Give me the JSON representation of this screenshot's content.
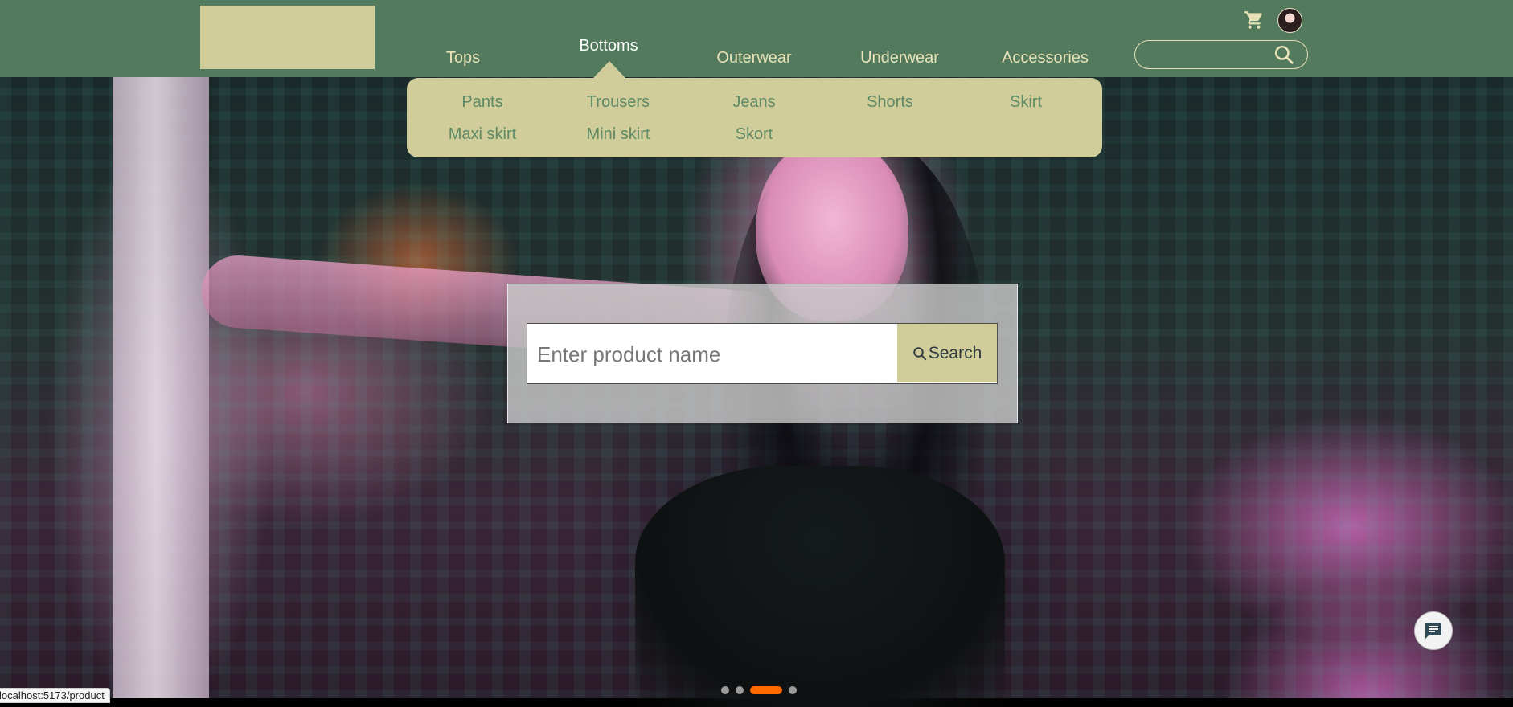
{
  "nav": {
    "items": [
      {
        "label": "Tops"
      },
      {
        "label": "Bottoms"
      },
      {
        "label": "Outerwear"
      },
      {
        "label": "Underwear"
      },
      {
        "label": "Accessories"
      }
    ],
    "active": "Bottoms"
  },
  "header": {
    "search_placeholder": "",
    "icons": {
      "cart": "cart-icon",
      "search": "search-icon"
    }
  },
  "dropdown": {
    "items": [
      {
        "label": "Pants"
      },
      {
        "label": "Trousers"
      },
      {
        "label": "Jeans"
      },
      {
        "label": "Shorts"
      },
      {
        "label": "Skirt"
      },
      {
        "label": "Maxi skirt"
      },
      {
        "label": "Mini skirt"
      },
      {
        "label": "Skort"
      }
    ]
  },
  "hero_search": {
    "placeholder": "Enter product name",
    "button_label": "Search"
  },
  "carousel": {
    "slide_count": 4,
    "active_index": 2
  },
  "status_bar": {
    "url": "localhost:5173/product"
  },
  "colors": {
    "header_bg": "#537a5d",
    "accent": "#d0cd9a",
    "nav_text": "#e7e2b8",
    "dropdown_text": "#5e8a66",
    "carousel_active": "#ff6a00"
  }
}
